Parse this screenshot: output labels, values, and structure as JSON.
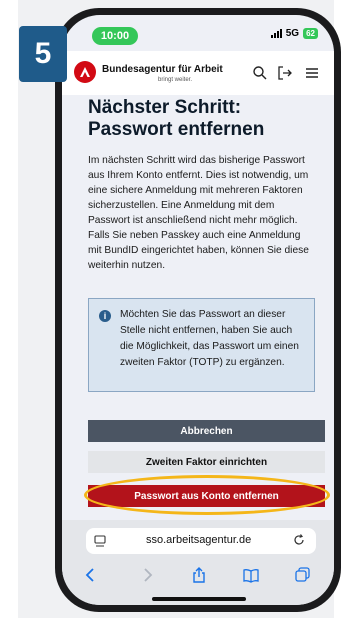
{
  "step": {
    "number": "5"
  },
  "status_bar": {
    "time": "10:00",
    "network": "5G",
    "battery": "62"
  },
  "header": {
    "logo_text": "Bundesagentur für Arbeit",
    "logo_sub": "bringt weiter."
  },
  "main": {
    "title": "Nächster Schritt: Passwort entfernen",
    "intro": "Im nächsten Schritt wird das bisherige Passwort aus Ihrem Konto entfernt. Dies ist notwendig, um eine sichere Anmeldung mit mehreren Faktoren sicherzustellen. Eine Anmeldung mit dem Passwort ist anschließend nicht mehr möglich. Falls Sie neben Passkey auch eine Anmeldung mit BundID eingerichtet haben, können Sie diese weiterhin nutzen.",
    "info": "Möchten Sie das Passwort an dieser Stelle nicht entfernen, haben Sie auch die Möglichkeit, das Passwort um einen zweiten Faktor (TOTP) zu ergänzen."
  },
  "buttons": {
    "cancel": "Abbrechen",
    "second_factor": "Zweiten Faktor einrichten",
    "remove_password": "Passwort aus Konto entfernen"
  },
  "browser": {
    "url": "sso.arbeitsagentur.de"
  },
  "colors": {
    "step_badge": "#1f5b8a",
    "brand_red": "#d20a14",
    "primary_button": "#b3131b",
    "highlight": "#f4b619",
    "status_green": "#34c759",
    "info_bg": "#d9e4f0"
  }
}
